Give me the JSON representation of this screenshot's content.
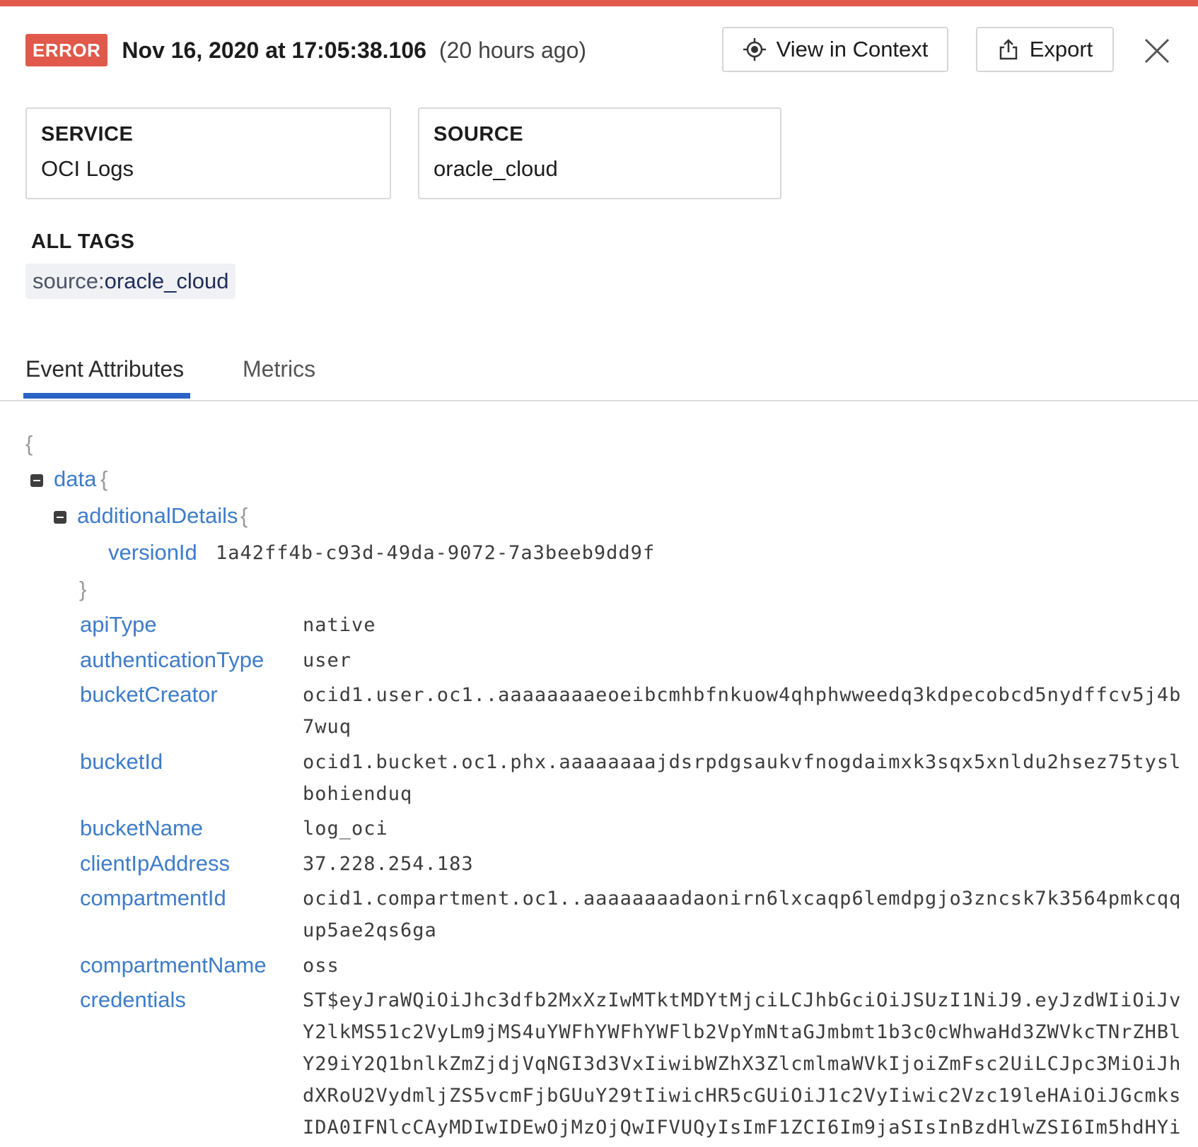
{
  "header": {
    "level": "ERROR",
    "timestamp": "Nov 16, 2020 at 17:05:38.106",
    "relative_time": "(20 hours ago)",
    "view_in_context_label": "View in Context",
    "export_label": "Export"
  },
  "cards": {
    "service_label": "SERVICE",
    "service_value": "OCI Logs",
    "source_label": "SOURCE",
    "source_value": "oracle_cloud"
  },
  "tags": {
    "title": "ALL TAGS",
    "items": [
      {
        "key": "source:",
        "value": "oracle_cloud"
      }
    ]
  },
  "tabs": [
    {
      "label": "Event Attributes",
      "active": true
    },
    {
      "label": "Metrics",
      "active": false
    }
  ],
  "json_tree": {
    "open_brace": "{",
    "close_brace": "}",
    "data_key": "data",
    "additional_details_key": "additionalDetails",
    "version_id": {
      "key": "versionId",
      "value": "1a42ff4b-c93d-49da-9072-7a3beeb9dd9f"
    },
    "attributes": [
      {
        "key": "apiType",
        "value": "native"
      },
      {
        "key": "authenticationType",
        "value": "user"
      },
      {
        "key": "bucketCreator",
        "value_lines": [
          "ocid1.user.oc1..aaaaaaaaeoeibcmhbfnkuow4qhphwweedq3kdpecobcd5nydffcv5j4b",
          "7wuq"
        ]
      },
      {
        "key": "bucketId",
        "value_lines": [
          "ocid1.bucket.oc1.phx.aaaaaaaajdsrpdgsaukvfnogdaimxk3sqx5xnldu2hsez75tysl",
          "bohienduq"
        ]
      },
      {
        "key": "bucketName",
        "value": "log_oci"
      },
      {
        "key": "clientIpAddress",
        "value": "37.228.254.183"
      },
      {
        "key": "compartmentId",
        "value_lines": [
          "ocid1.compartment.oc1..aaaaaaaadaonirn6lxcaqp6lemdpgjo3zncsk7k3564pmkcqq",
          "up5ae2qs6ga"
        ]
      },
      {
        "key": "compartmentName",
        "value": "oss"
      },
      {
        "key": "credentials",
        "value_lines": [
          "ST$eyJraWQiOiJhc3dfb2MxXzIwMTktMDYtMjciLCJhbGciOiJSUzI1NiJ9.eyJzdWIiOiJv",
          "Y2lkMS51c2VyLm9jMS4uYWFhYWFhYWFlb2VpYmNtaGJmbmt1b3c0cWhwaHd3ZWVkcTNrZHBl",
          "Y29iY2Q1bnlkZmZjdjVqNGI3d3VxIiwibWZhX3ZlcmlmaWVkIjoiZmFsc2UiLCJpc3MiOiJh",
          "dXRoU2VydmljZS5vcmFjbGUuY29tIiwicHR5cGUiOiJ1c2VyIiwic2Vzc19leHAiOiJGcmks",
          "IDA0IFNlcCAyMDIwIDEwOjMzOjQwIFVUQyIsImF1ZCI6Im9jaSIsInBzdHlwZSI6Im5hdHYi"
        ]
      }
    ]
  }
}
